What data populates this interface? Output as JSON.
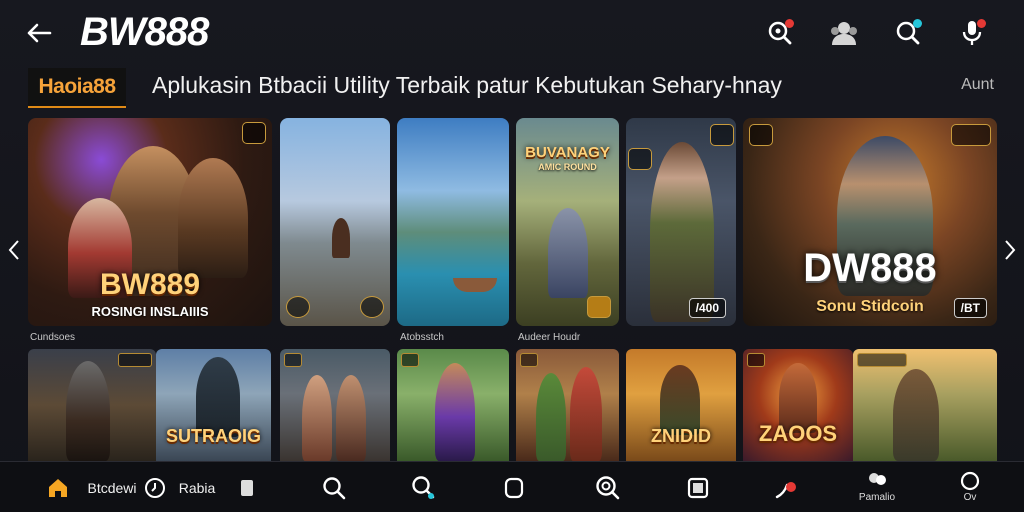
{
  "header": {
    "title": "BW888",
    "icons": [
      "search-bug-icon",
      "user-group-icon",
      "search-icon",
      "microphone-icon"
    ]
  },
  "subheader": {
    "logo_text": "Haoia88",
    "tagline": "Aplukasin Btbacii Utility Terbaik patur Kebutukan Sehary-hnay",
    "more_label": "Aunt"
  },
  "featured": [
    {
      "title": "BW889",
      "subtitle": "ROSINGI INSLAIIIS"
    },
    {
      "title": "",
      "subtitle": ""
    },
    {
      "title": "",
      "subtitle": ""
    },
    {
      "title": "BUVANAGY",
      "subtitle": "AMIC ROUND"
    },
    {
      "title": "",
      "subtitle": "",
      "chip": "/400"
    },
    {
      "title": "DW888",
      "subtitle": "Sonu Stidcoin",
      "chip": "/BT"
    }
  ],
  "section_labels": [
    "Cundsoes",
    "Atobsstch",
    "Audeer Houdr"
  ],
  "thumbnails": [
    {
      "title": ""
    },
    {
      "title": "SUTRAOIG"
    },
    {
      "title": ""
    },
    {
      "title": ""
    },
    {
      "title": ""
    },
    {
      "title": "ZNIDID"
    },
    {
      "title": "ZAOOS"
    },
    {
      "title": ""
    }
  ],
  "bottom_nav": {
    "item1_label": "Btcdewi",
    "item2_label": "Rabia",
    "item_last_small": "Pamalio",
    "item_end_small": "Ov",
    "icons": [
      "home-icon",
      "clock-icon",
      "square-icon",
      "search-icon",
      "search-pin-icon",
      "app-icon",
      "target-search-icon",
      "stop-icon",
      "pin-icon",
      "profile-icon",
      "help-icon"
    ]
  },
  "colors": {
    "accent": "#f6a33a",
    "home": "#f5a623",
    "alert": "#e53935",
    "teal": "#26c6da"
  }
}
